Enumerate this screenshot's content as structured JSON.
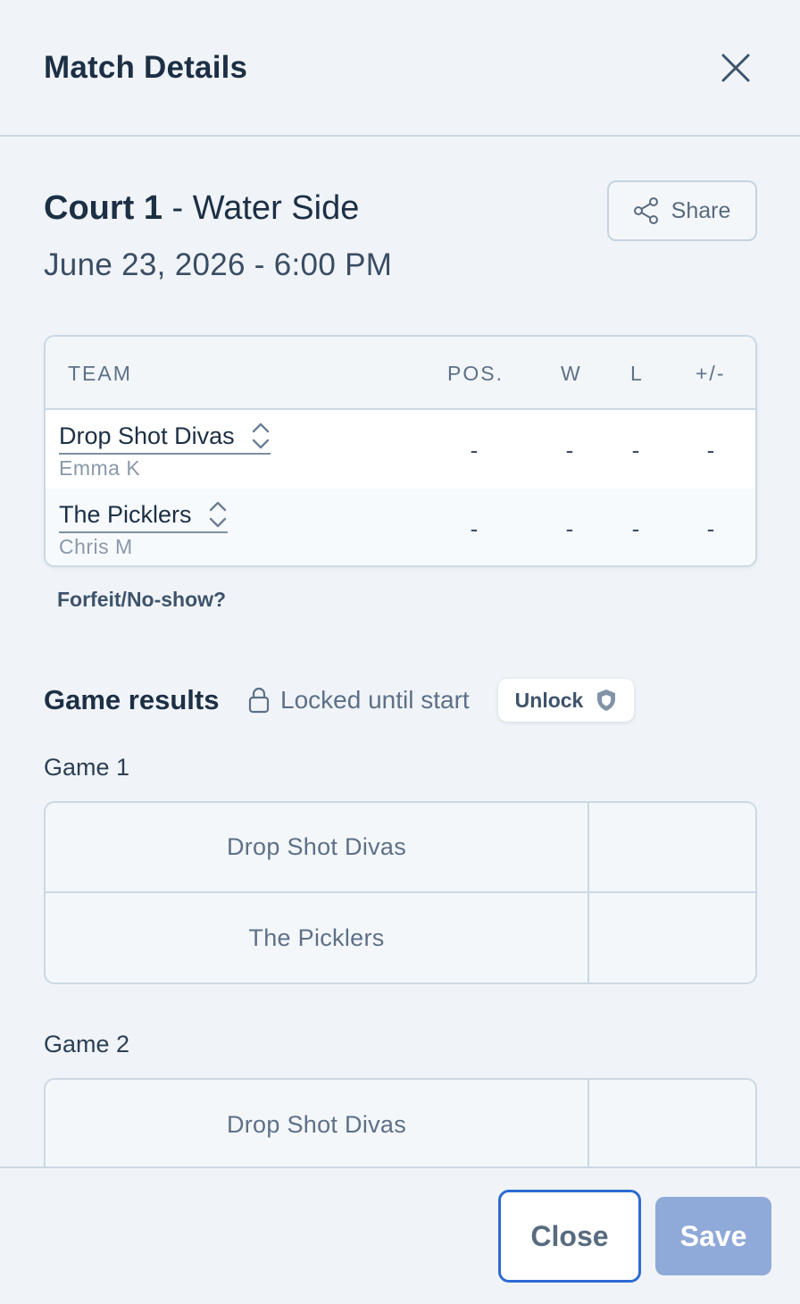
{
  "header": {
    "title": "Match Details"
  },
  "match": {
    "court": "Court 1",
    "separator": " - ",
    "location": "Water Side",
    "datetime": "June 23, 2026 - 6:00 PM",
    "share_label": "Share"
  },
  "standings": {
    "columns": [
      "TEAM",
      "POS.",
      "W",
      "L",
      "+/-"
    ],
    "rows": [
      {
        "team": "Drop Shot Divas",
        "player": "Emma K",
        "pos": "-",
        "w": "-",
        "l": "-",
        "diff": "-"
      },
      {
        "team": "The Picklers",
        "player": "Chris M",
        "pos": "-",
        "w": "-",
        "l": "-",
        "diff": "-"
      }
    ]
  },
  "forfeit_label": "Forfeit/No-show?",
  "results": {
    "title": "Game results",
    "locked_text": "Locked until start",
    "unlock_label": "Unlock",
    "games": [
      {
        "label": "Game 1",
        "teams": [
          "Drop Shot Divas",
          "The Picklers"
        ]
      },
      {
        "label": "Game 2",
        "teams": [
          "Drop Shot Divas"
        ]
      }
    ]
  },
  "footer": {
    "close_label": "Close",
    "save_label": "Save"
  },
  "colors": {
    "accent": "#2d6bd4",
    "save_disabled": "#8fa9d8",
    "text": "#1c2f45",
    "muted": "#5d7088"
  }
}
